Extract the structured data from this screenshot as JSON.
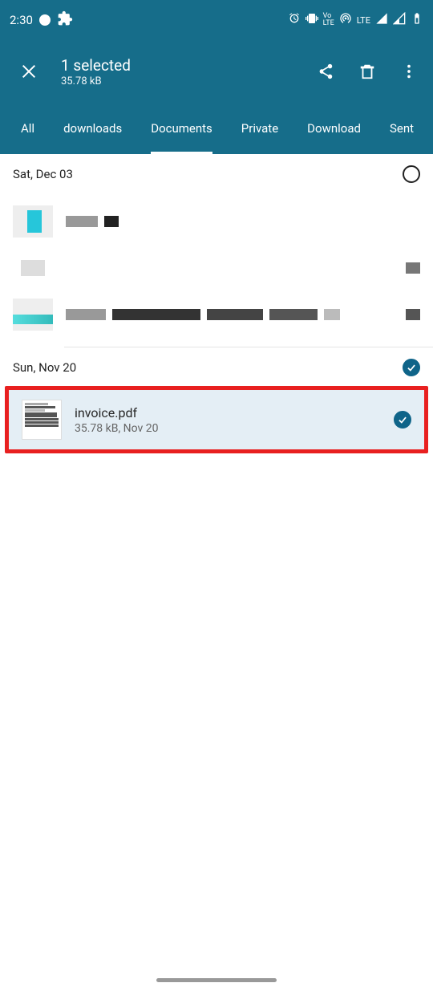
{
  "status": {
    "time": "2:30",
    "lte": "LTE"
  },
  "appbar": {
    "title": "1 selected",
    "subtitle": "35.78 kB"
  },
  "tabs": [
    {
      "label": "All",
      "active": false
    },
    {
      "label": "downloads",
      "active": false
    },
    {
      "label": "Documents",
      "active": true
    },
    {
      "label": "Private",
      "active": false
    },
    {
      "label": "Download",
      "active": false
    },
    {
      "label": "Sent",
      "active": false
    }
  ],
  "sections": [
    {
      "date": "Sat, Dec 03",
      "all_selected": false
    },
    {
      "date": "Sun, Nov 20",
      "all_selected": true
    }
  ],
  "selected_file": {
    "name": "invoice.pdf",
    "meta": "35.78 kB, Nov 20"
  }
}
